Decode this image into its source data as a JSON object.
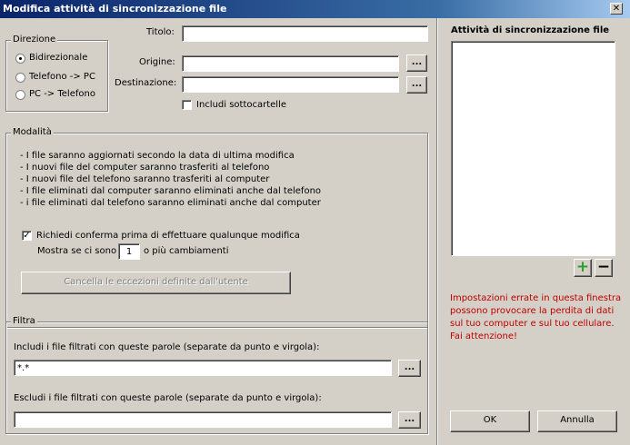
{
  "window": {
    "title": "Modifica attività di sincronizzazione file",
    "close_glyph": "✕"
  },
  "direction": {
    "legend": "Direzione",
    "options": [
      {
        "label": "Bidirezionale",
        "selected": true
      },
      {
        "label": "Telefono -> PC",
        "selected": false
      },
      {
        "label": "PC -> Telefono",
        "selected": false
      }
    ]
  },
  "form": {
    "title_label": "Titolo:",
    "title_value": "",
    "origin_label": "Origine:",
    "origin_value": "",
    "destination_label": "Destinazione:",
    "destination_value": "",
    "browse_label": "...",
    "include_subfolders_label": "Includi sottocartelle",
    "include_subfolders_checked": false
  },
  "mode": {
    "legend": "Modalità",
    "lines": [
      "- I file saranno aggiornati secondo la data di ultima modifica",
      "- I nuovi file del computer saranno trasferiti al telefono",
      "- I nuovi file del telefono saranno trasferiti al computer",
      "- I file eliminati dal computer saranno eliminati anche dal telefono",
      "- i file eliminati dal telefono saranno eliminati anche dal computer"
    ],
    "confirm_label": "Richiedi conferma prima di effettuare qualunque modifica",
    "confirm_checked": true,
    "show_prefix": "Mostra se ci sono",
    "show_count": "1",
    "show_suffix": "o più cambiamenti",
    "clear_exceptions_label": "Cancella le eccezioni definite dall'utente"
  },
  "filter": {
    "legend": "Filtra",
    "include_label": "Includi i file filtrati con queste parole (separate da punto e virgola):",
    "include_value": "*.*",
    "exclude_label": "Escludi i file filtrati con queste parole (separate da punto e virgola):",
    "exclude_value": "",
    "browse_label": "..."
  },
  "sidebar": {
    "heading": "Attività di sincronizzazione file",
    "add_glyph": "+",
    "remove_glyph": "−",
    "warning": "Impostazioni errate in questa finestra possono provocare la perdita di dati sul tuo computer e sul tuo cellulare. Fai attenzione!",
    "ok_label": "OK",
    "cancel_label": "Annulla"
  },
  "colors": {
    "add": "#2e9e2e",
    "warning": "#c00000",
    "titlebar": "#0a246a"
  }
}
